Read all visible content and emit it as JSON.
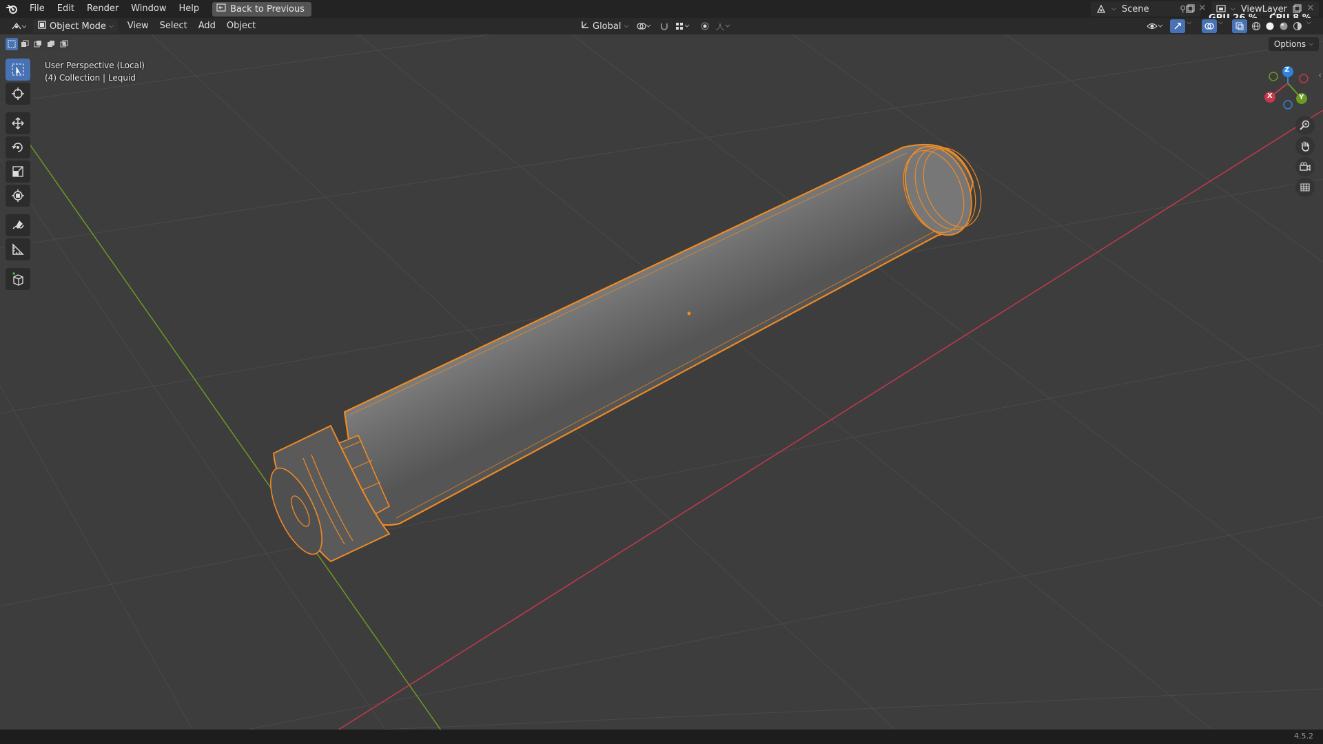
{
  "menu": {
    "items": [
      "File",
      "Edit",
      "Render",
      "Window",
      "Help"
    ],
    "back_button": "Back to Previous"
  },
  "scene": {
    "label": "Scene"
  },
  "view_layer": {
    "label": "ViewLayer"
  },
  "perf": {
    "gpu": "GPU  26 %",
    "cpu": "CPU  8 %"
  },
  "header": {
    "mode": "Object Mode",
    "menus": [
      "View",
      "Select",
      "Add",
      "Object"
    ],
    "transform_orientation": "Global"
  },
  "viewport": {
    "perspective": "User Perspective (Local)",
    "collection": "(4) Collection | Lequid",
    "options_label": "Options"
  },
  "gizmo": {
    "x": "X",
    "y": "Y",
    "z": "Z"
  },
  "status": {
    "version": "4.5.2"
  },
  "colors": {
    "selection_outline": "#f08a24",
    "x_axis": "#c8374f",
    "y_axis": "#6c9a23",
    "z_axis": "#2f83e0",
    "accent": "#4772b3"
  }
}
